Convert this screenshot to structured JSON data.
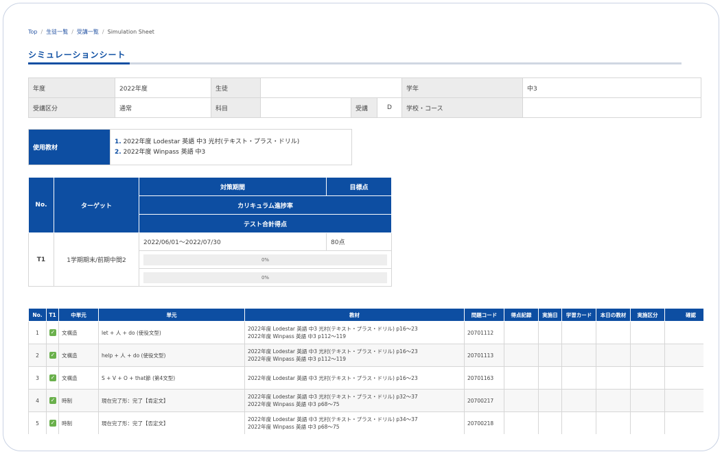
{
  "breadcrumb": [
    "Top",
    "生徒一覧",
    "受講一覧",
    "Simulation Sheet"
  ],
  "page_title": "シミュレーションシート",
  "info": {
    "year_label": "年度",
    "year_value": "2022年度",
    "student_label": "生徒",
    "student_value": "",
    "grade_label": "学年",
    "grade_value": "中3",
    "category_label": "受講区分",
    "category_value": "通常",
    "subject_label": "科目",
    "subject_value": "",
    "code_label": "受講",
    "code_value": "D",
    "school_label": "学校・コース",
    "school_value": ""
  },
  "materials": {
    "label": "使用教材",
    "items": [
      {
        "num": "1.",
        "text": "2022年度 Lodestar 英語 中3 光村(テキスト・プラス・ドリル)"
      },
      {
        "num": "2.",
        "text": "2022年度 Winpass 英語 中3"
      }
    ]
  },
  "target": {
    "headers": {
      "no": "No.",
      "target": "ターゲット",
      "period": "対策期間",
      "goal": "目標点",
      "curriculum": "カリキュラム進捗率",
      "total": "テスト合計得点"
    },
    "rows": [
      {
        "no": "T1",
        "name": "1学期期末/前期中間2",
        "period": "2022/06/01〜2022/07/30",
        "goal": "80点",
        "curriculum_progress": "0%",
        "total_progress": "0%"
      }
    ]
  },
  "schedule": {
    "headers": [
      "No.",
      "T1",
      "中単元",
      "単元",
      "教材",
      "問題コード",
      "得点記録",
      "実施日",
      "学習カード",
      "本日の教材",
      "実施区分",
      "確認"
    ],
    "rows": [
      {
        "no": "1",
        "checked": true,
        "mid": "文構造",
        "unit": "let + 人 + do (使役文型)",
        "materials": [
          "2022年度 Lodestar 英語 中3 光村(テキスト・プラス・ドリル) p16〜23",
          "2022年度 Winpass 英語 中3 p112〜119"
        ],
        "code": "20701112"
      },
      {
        "no": "2",
        "checked": true,
        "mid": "文構造",
        "unit": "help + 人 + do (使役文型)",
        "materials": [
          "2022年度 Lodestar 英語 中3 光村(テキスト・プラス・ドリル) p16〜23",
          "2022年度 Winpass 英語 中3 p112〜119"
        ],
        "code": "20701113"
      },
      {
        "no": "3",
        "checked": true,
        "mid": "文構造",
        "unit": "S + V + O + that節 (第4文型)",
        "materials": [
          "2022年度 Lodestar 英語 中3 光村(テキスト・プラス・ドリル) p16〜23"
        ],
        "code": "20701163"
      },
      {
        "no": "4",
        "checked": true,
        "mid": "時制",
        "unit": "現在完了形：完了【肯定文】",
        "materials": [
          "2022年度 Lodestar 英語 中3 光村(テキスト・プラス・ドリル) p32〜37",
          "2022年度 Winpass 英語 中3 p68〜75"
        ],
        "code": "20700217"
      },
      {
        "no": "5",
        "checked": true,
        "mid": "時制",
        "unit": "現在完了形：完了【否定文】",
        "materials": [
          "2022年度 Lodestar 英語 中3 光村(テキスト・プラス・ドリル) p34〜37",
          "2022年度 Winpass 英語 中3 p68〜75"
        ],
        "code": "20700218"
      }
    ]
  },
  "colors": {
    "primary": "#0d4ea2",
    "check": "#6ab04c"
  },
  "icons": {
    "check": "check-icon"
  }
}
